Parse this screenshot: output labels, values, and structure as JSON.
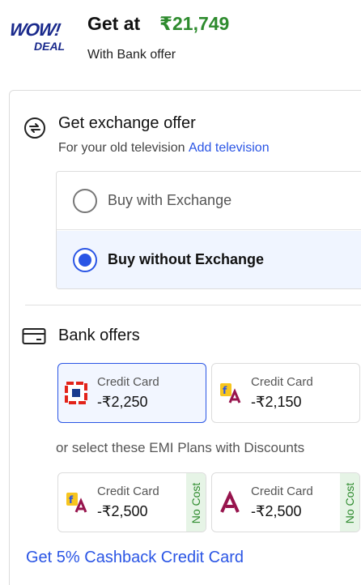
{
  "deal": {
    "logo_wow": "WOW!",
    "logo_deal": "DEAL",
    "get_at": "Get at",
    "price": "₹21,749",
    "subtitle": "With Bank offer"
  },
  "exchange": {
    "title": "Get exchange offer",
    "subtitle": "For your old television",
    "link": "Add television",
    "options": [
      {
        "label": "Buy with Exchange",
        "selected": false
      },
      {
        "label": "Buy without Exchange",
        "selected": true
      }
    ]
  },
  "bank_offers": {
    "title": "Bank offers",
    "cards": [
      {
        "type": "Credit Card",
        "amount": "-₹2,250",
        "bank": "hdfc",
        "selected": true
      },
      {
        "type": "Credit Card",
        "amount": "-₹2,150",
        "bank": "flipkart-axis",
        "selected": false
      }
    ],
    "emi_heading": "or select these EMI Plans with Discounts",
    "emi_cards": [
      {
        "type": "Credit Card",
        "amount": "-₹2,500",
        "bank": "flipkart-axis",
        "badge": "No Cost"
      },
      {
        "type": "Credit Card",
        "amount": "-₹2,500",
        "bank": "axis",
        "badge": "No Cost"
      }
    ],
    "cashback_link": "Get 5% Cashback Credit Card"
  },
  "colors": {
    "accent": "#2a55e5",
    "price_green": "#2e8b2e",
    "logo_navy": "#1a2a8c",
    "hdfc_red": "#e2231a",
    "axis_maroon": "#97144d",
    "flipkart_yellow": "#f7c51e"
  },
  "icons": {
    "exchange": "exchange-icon",
    "bank": "card-icon"
  }
}
